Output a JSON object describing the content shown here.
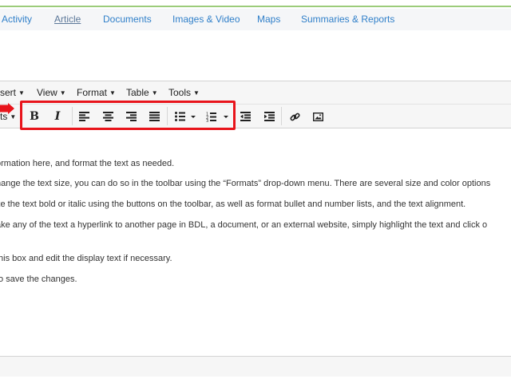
{
  "tabs": [
    {
      "label": "Activity",
      "active": false
    },
    {
      "label": "Article",
      "active": true
    },
    {
      "label": "Documents",
      "active": false
    },
    {
      "label": "Images & Video",
      "active": false
    },
    {
      "label": "Maps",
      "active": false
    },
    {
      "label": "Summaries & Reports",
      "active": false
    }
  ],
  "menubar": {
    "insert": "sert",
    "view": "View",
    "format": "Format",
    "table": "Table",
    "tools": "Tools"
  },
  "toolbar": {
    "formats": "ts",
    "bold": "B",
    "italic": "I"
  },
  "icons": {
    "bold": "bold-icon",
    "italic": "italic-icon",
    "align_left": "align-left-icon",
    "align_center": "align-center-icon",
    "align_right": "align-right-icon",
    "justify": "justify-icon",
    "bullet_list": "bullet-list-icon",
    "numbered_list": "numbered-list-icon",
    "outdent": "outdent-icon",
    "indent": "indent-icon",
    "link": "link-icon",
    "image": "image-icon"
  },
  "content": {
    "line1": "ormation here, and format the text as needed.",
    "line2": "hange the text size, you can do so in the toolbar using the “Formats” drop-down menu. There are several size and color options",
    "line3": "ke the text bold or italic using the buttons on the toolbar, as well as format bullet and number lists, and the text alignment.",
    "line4": "ake any of the text a hyperlink to another page in BDL, a document, or an external website, simply highlight the text and click o",
    "line5": "this box and edit the display text if necessary.",
    "line6": "to save the changes."
  },
  "colors": {
    "tab_link": "#2f7fc9",
    "tab_active": "#5c7899",
    "highlight": "#e8141b",
    "accent": "#9ccc7a"
  }
}
